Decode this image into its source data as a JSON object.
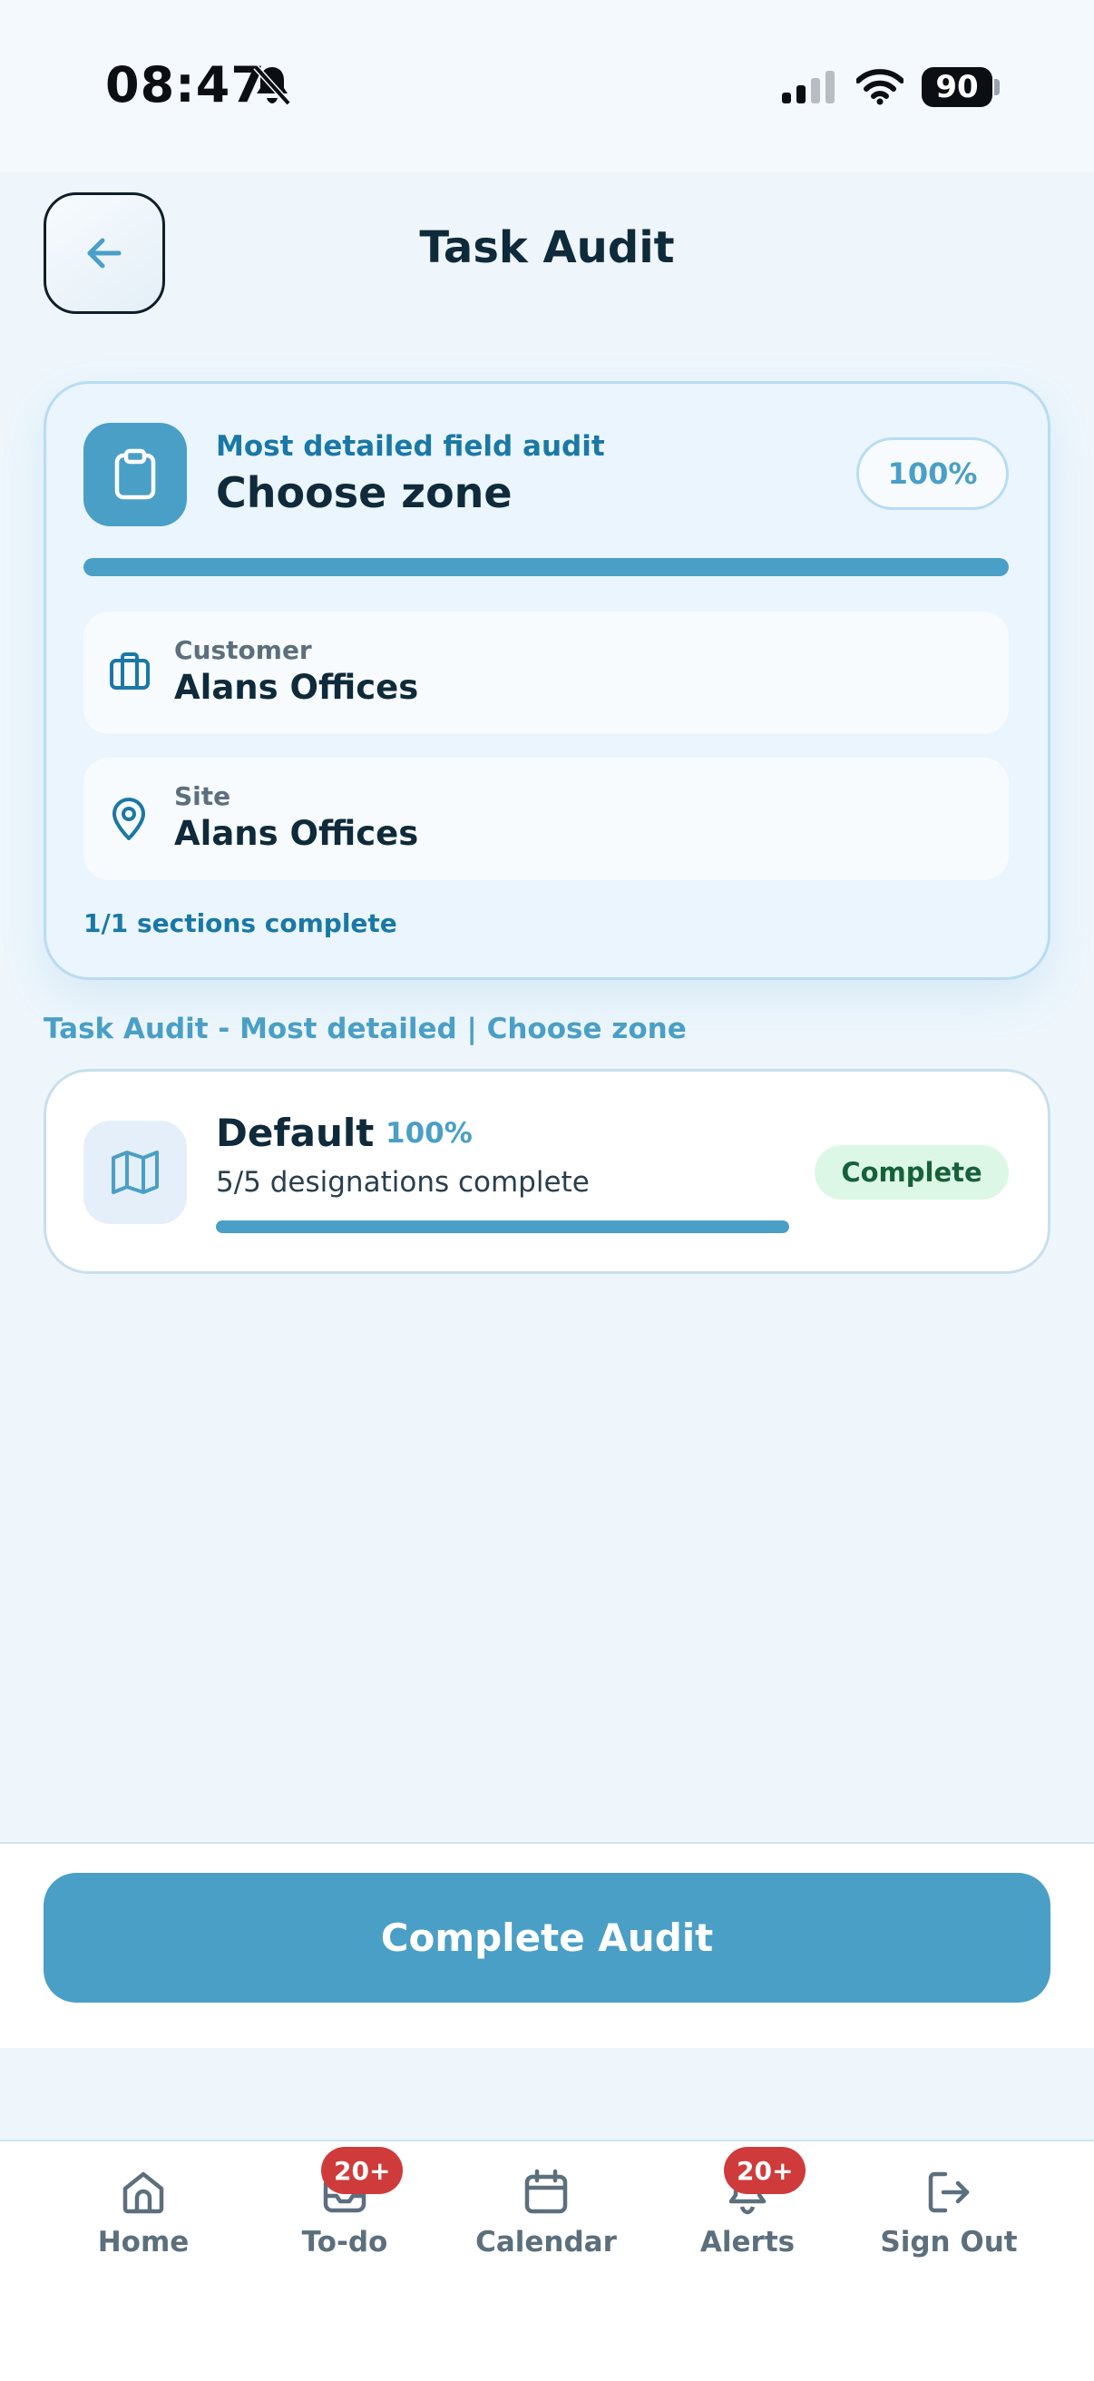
{
  "status_bar": {
    "time": "08:47",
    "battery": "90"
  },
  "header": {
    "title": "Task Audit"
  },
  "summary": {
    "subtitle": "Most detailed field audit",
    "title": "Choose zone",
    "percent_label": "100%",
    "progress": 1.0,
    "customer_label": "Customer",
    "customer_value": "Alans Offices",
    "site_label": "Site",
    "site_value": "Alans Offices",
    "sections_text": "1/1 sections complete"
  },
  "breadcrumb": "Task Audit - Most detailed | Choose zone",
  "zone": {
    "name": "Default",
    "percent_label": "100%",
    "description": "5/5 designations complete",
    "progress": 1.0,
    "status": "Complete"
  },
  "action": {
    "complete_label": "Complete Audit"
  },
  "nav": {
    "items": [
      {
        "label": "Home",
        "icon": "home-icon"
      },
      {
        "label": "To-do",
        "icon": "inbox-icon",
        "badge": "20+"
      },
      {
        "label": "Calendar",
        "icon": "calendar-icon"
      },
      {
        "label": "Alerts",
        "icon": "bell-icon",
        "badge": "20+"
      },
      {
        "label": "Sign Out",
        "icon": "sign-out-icon"
      }
    ]
  },
  "colors": {
    "accent": "#4a9fc6",
    "accent_dark": "#1a78a6",
    "text": "#0f2a3a",
    "badge_red": "#cf3b3b",
    "success_bg": "#dcf7e6",
    "success_text": "#16603a"
  }
}
